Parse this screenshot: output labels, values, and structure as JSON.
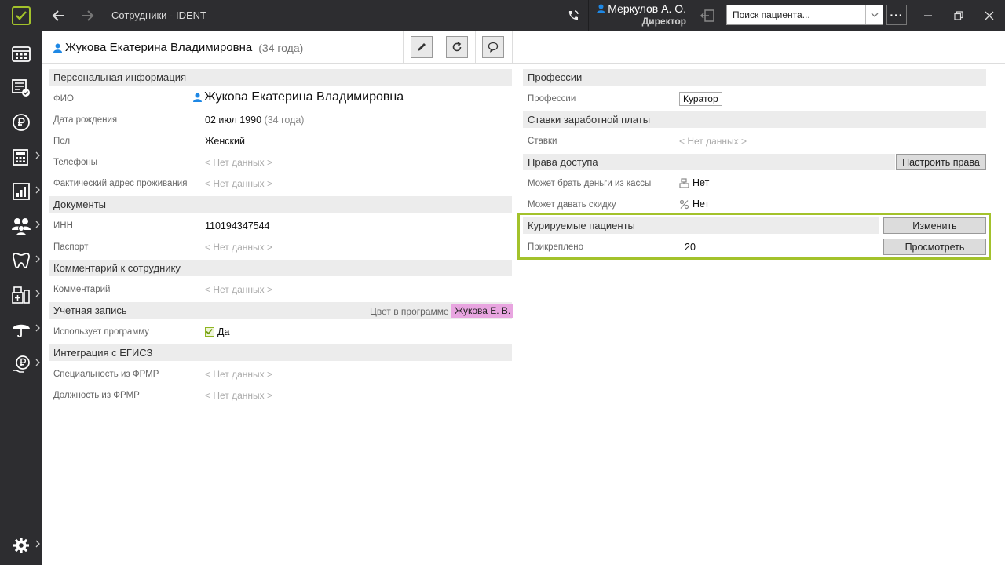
{
  "window": {
    "title": "Сотрудники - IDENT",
    "search_placeholder": "Поиск пациента...",
    "more_label": "···"
  },
  "user": {
    "name": "Меркулов А. О.",
    "role": "Директор"
  },
  "header": {
    "employee_name": "Жукова Екатерина Владимировна",
    "employee_age": "(34 года)"
  },
  "left": {
    "personal": {
      "title": "Персональная информация",
      "rows": [
        {
          "label": "ФИО",
          "value": "Жукова Екатерина Владимировна"
        },
        {
          "label": "Дата рождения",
          "value": "02 июл 1990",
          "extra": "(34 года)"
        },
        {
          "label": "Пол",
          "value": "Женский"
        },
        {
          "label": "Телефоны",
          "value": "< Нет данных >"
        },
        {
          "label": "Фактический адрес проживания",
          "value": "< Нет данных >"
        }
      ]
    },
    "documents": {
      "title": "Документы",
      "rows": [
        {
          "label": "ИНН",
          "value": "110194347544"
        },
        {
          "label": "Паспорт",
          "value": "< Нет данных >"
        }
      ]
    },
    "comment": {
      "title": "Комментарий к сотруднику",
      "rows": [
        {
          "label": "Комментарий",
          "value": "< Нет данных >"
        }
      ]
    },
    "account": {
      "title": "Учетная запись",
      "color_label": "Цвет в программе",
      "color_tag": "Жукова Е. В.",
      "color_hex": "#e8a5e0",
      "rows": [
        {
          "label": "Использует программу",
          "value": "Да",
          "checked": true
        }
      ]
    },
    "egisz": {
      "title": "Интеграция с ЕГИСЗ",
      "rows": [
        {
          "label": "Специальность из ФРМР",
          "value": "< Нет данных >"
        },
        {
          "label": "Должность из ФРМР",
          "value": "< Нет данных >"
        }
      ]
    }
  },
  "right": {
    "professions": {
      "title": "Профессии",
      "label": "Профессии",
      "tag": "Куратор"
    },
    "salary": {
      "title": "Ставки заработной платы",
      "label": "Ставки",
      "value": "< Нет данных >"
    },
    "access": {
      "title": "Права доступа",
      "button": "Настроить права",
      "rows": [
        {
          "label": "Может брать деньги из кассы",
          "value": "Нет"
        },
        {
          "label": "Может давать скидку",
          "value": "Нет"
        }
      ]
    },
    "curated": {
      "title": "Курируемые пациенты",
      "change_button": "Изменить",
      "label": "Прикреплено",
      "value": "20",
      "view_button": "Просмотреть"
    }
  },
  "colors": {
    "accent": "#a3c22b",
    "chrome": "#2d2d30",
    "user_icon": "#1e88e5"
  }
}
